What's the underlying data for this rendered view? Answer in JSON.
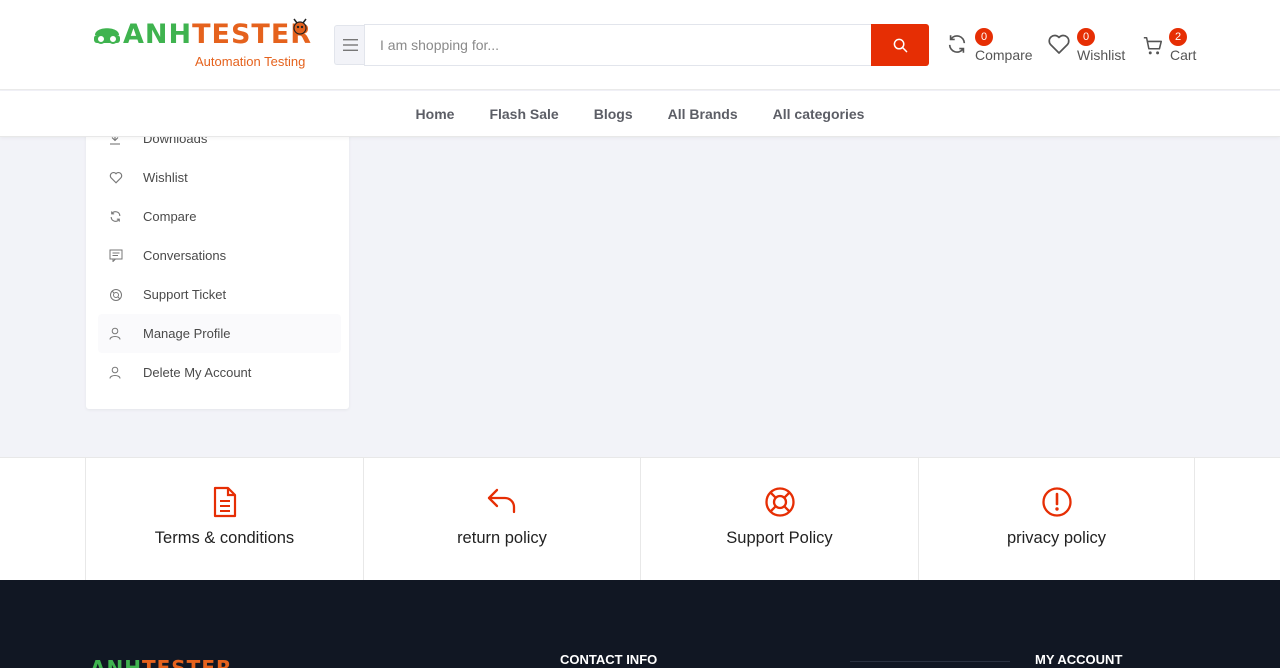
{
  "header": {
    "logo_part1": "ANH",
    "logo_part2": "TESTER",
    "logo_tagline": "Automation Testing",
    "search_placeholder": "I am shopping for...",
    "compare_label": "Compare",
    "compare_count": "0",
    "wishlist_label": "Wishlist",
    "wishlist_count": "0",
    "cart_label": "Cart",
    "cart_count": "2"
  },
  "nav": {
    "items": [
      "Home",
      "Flash Sale",
      "Blogs",
      "All Brands",
      "All categories"
    ]
  },
  "sidebar": {
    "items": [
      {
        "label": "Downloads",
        "icon": "download-icon"
      },
      {
        "label": "Wishlist",
        "icon": "heart-icon"
      },
      {
        "label": "Compare",
        "icon": "refresh-icon"
      },
      {
        "label": "Conversations",
        "icon": "chat-icon"
      },
      {
        "label": "Support Ticket",
        "icon": "support-icon"
      },
      {
        "label": "Manage Profile",
        "icon": "user-icon"
      },
      {
        "label": "Delete My Account",
        "icon": "user-icon"
      }
    ]
  },
  "policies": {
    "items": [
      {
        "label": "Terms & conditions",
        "icon": "document-icon"
      },
      {
        "label": "return policy",
        "icon": "reply-arrow-icon"
      },
      {
        "label": "Support Policy",
        "icon": "lifebuoy-icon"
      },
      {
        "label": "privacy policy",
        "icon": "alert-circle-icon"
      }
    ]
  },
  "footer": {
    "logo_part1": "ANH",
    "logo_part2": "TESTER",
    "contact_heading": "CONTACT INFO",
    "account_heading": "MY ACCOUNT"
  },
  "colors": {
    "accent": "#e62e04",
    "logo_green": "#3fb34f",
    "logo_orange": "#e5621d",
    "footer_bg": "#111723",
    "page_bg": "#f2f3f8"
  }
}
